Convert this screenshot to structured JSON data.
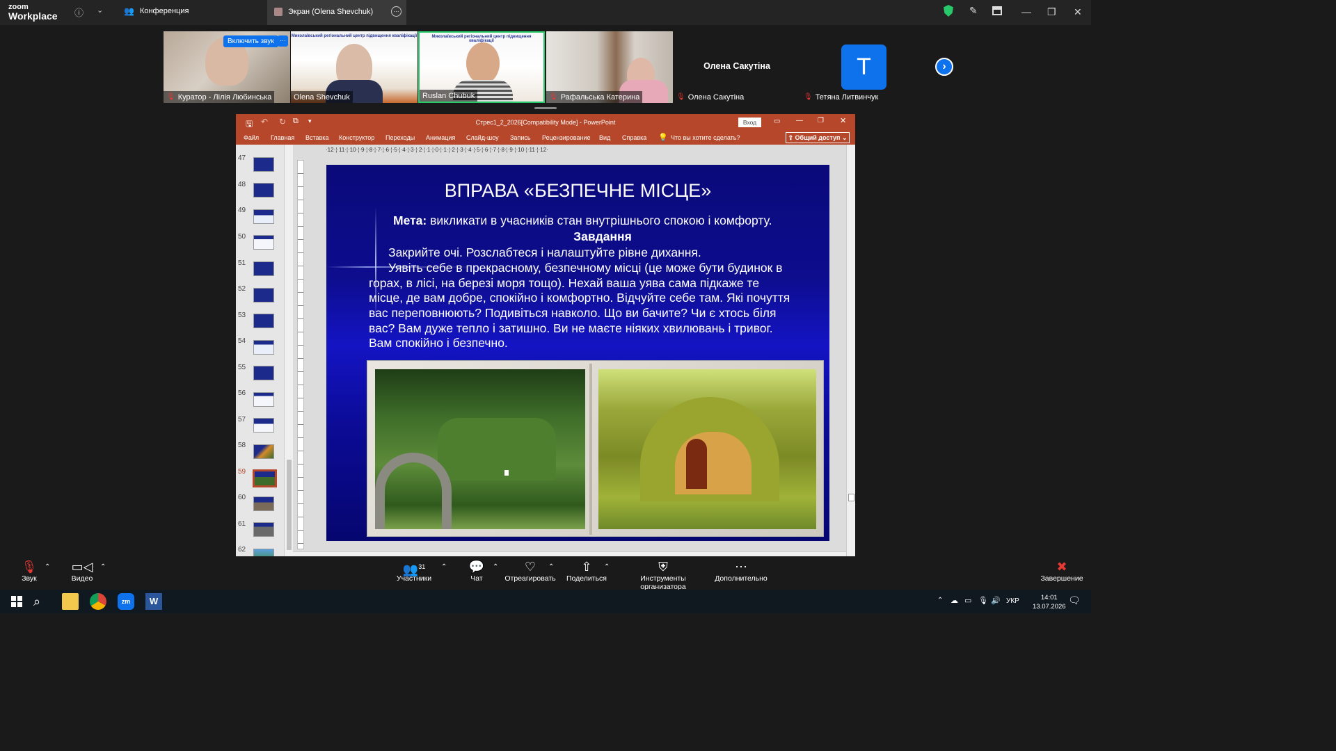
{
  "zoom": {
    "logo_top": "zoom",
    "logo_bottom": "Workplace",
    "meeting_tab": "Конференция",
    "screen_tab": "Экран (Olena Shevchuk)",
    "colors": {
      "accent": "#0e72ed",
      "active_speaker": "#27c96b",
      "mic_off": "#e53935"
    }
  },
  "participants": {
    "unmute_button": "Включить звук",
    "more_button": "···",
    "tiles": [
      {
        "name": "Куратор - Лілія Любинська",
        "muted": true
      },
      {
        "name": "Olena Shevchuk",
        "muted": false,
        "header": "Миколаївський регіональний центр підвищення кваліфікації"
      },
      {
        "name": "Ruslan Chubuk",
        "muted": false,
        "header": "Миколаївський регіональний центр підвищення кваліфікації"
      },
      {
        "name": "Рафальська Катерина",
        "muted": true
      },
      {
        "name": "Олена Сакутіна",
        "muted": true,
        "display_name": "Олена Сакутіна"
      },
      {
        "name": "Тетяна Литвинчук",
        "muted": true,
        "avatar_letter": "T"
      }
    ]
  },
  "powerpoint": {
    "title": "Cтрес1_2_2026[Compatibility Mode] - PowerPoint",
    "signin": "Вход",
    "menu": [
      "Файл",
      "Главная",
      "Вставка",
      "Конструктор",
      "Переходы",
      "Анимация",
      "Слайд-шоу",
      "Запись",
      "Рецензирование",
      "Вид",
      "Справка"
    ],
    "tellme": "Что вы хотите сделать?",
    "share": "Общий доступ",
    "ruler": "·12·¦·11·¦·10·¦·9·¦·8·¦·7·¦·6·¦·5·¦·4·¦·3·¦·2·¦·1·¦·0·¦·1·¦·2·¦·3·¦·4·¦·5·¦·6·¦·7·¦·8·¦·9·¦·10·¦·11·¦·12·",
    "thumbnails": [
      "47",
      "48",
      "49",
      "50",
      "51",
      "52",
      "53",
      "54",
      "55",
      "56",
      "57",
      "58",
      "59",
      "60",
      "61",
      "62"
    ],
    "selected_slide": "59"
  },
  "slide": {
    "title": "ВПРАВА «БЕЗПЕЧНЕ МІСЦЕ»",
    "goal_label": "Мета:",
    "goal_text": " викликати в учасників стан внутрішнього спокою і комфорту.",
    "task_header": "Завдання",
    "lines": [
      "Закрийте очі. Розслабтеся і налаштуйте рівне дихання.",
      "Уявіть себе в прекрасному, безпечному місці (це може бути будинок в",
      "горах, в лісі, на березі моря тощо). Нехай ваша уява сама підкаже те",
      "місце, де вам добре, спокійно і комфортно. Відчуйте себе там. Які почуття",
      "вас переповнюють? Подивіться навколо. Що ви бачите? Чи є хтось біля",
      "вас? Вам дуже тепло і затишно. Ви не маєте ніяких хвилювань і тривог.",
      "Вам спокійно і безпечно."
    ]
  },
  "controls": {
    "audio": "Звук",
    "video": "Видео",
    "participants": "Участники",
    "participants_count": "31",
    "chat": "Чат",
    "react": "Отреагировать",
    "share": "Поделиться",
    "host_tools": "Инструменты организатора",
    "more": "Дополнительно",
    "end": "Завершение"
  },
  "taskbar": {
    "lang": "УКР",
    "time": "14:01",
    "date": "13.07.2026"
  }
}
